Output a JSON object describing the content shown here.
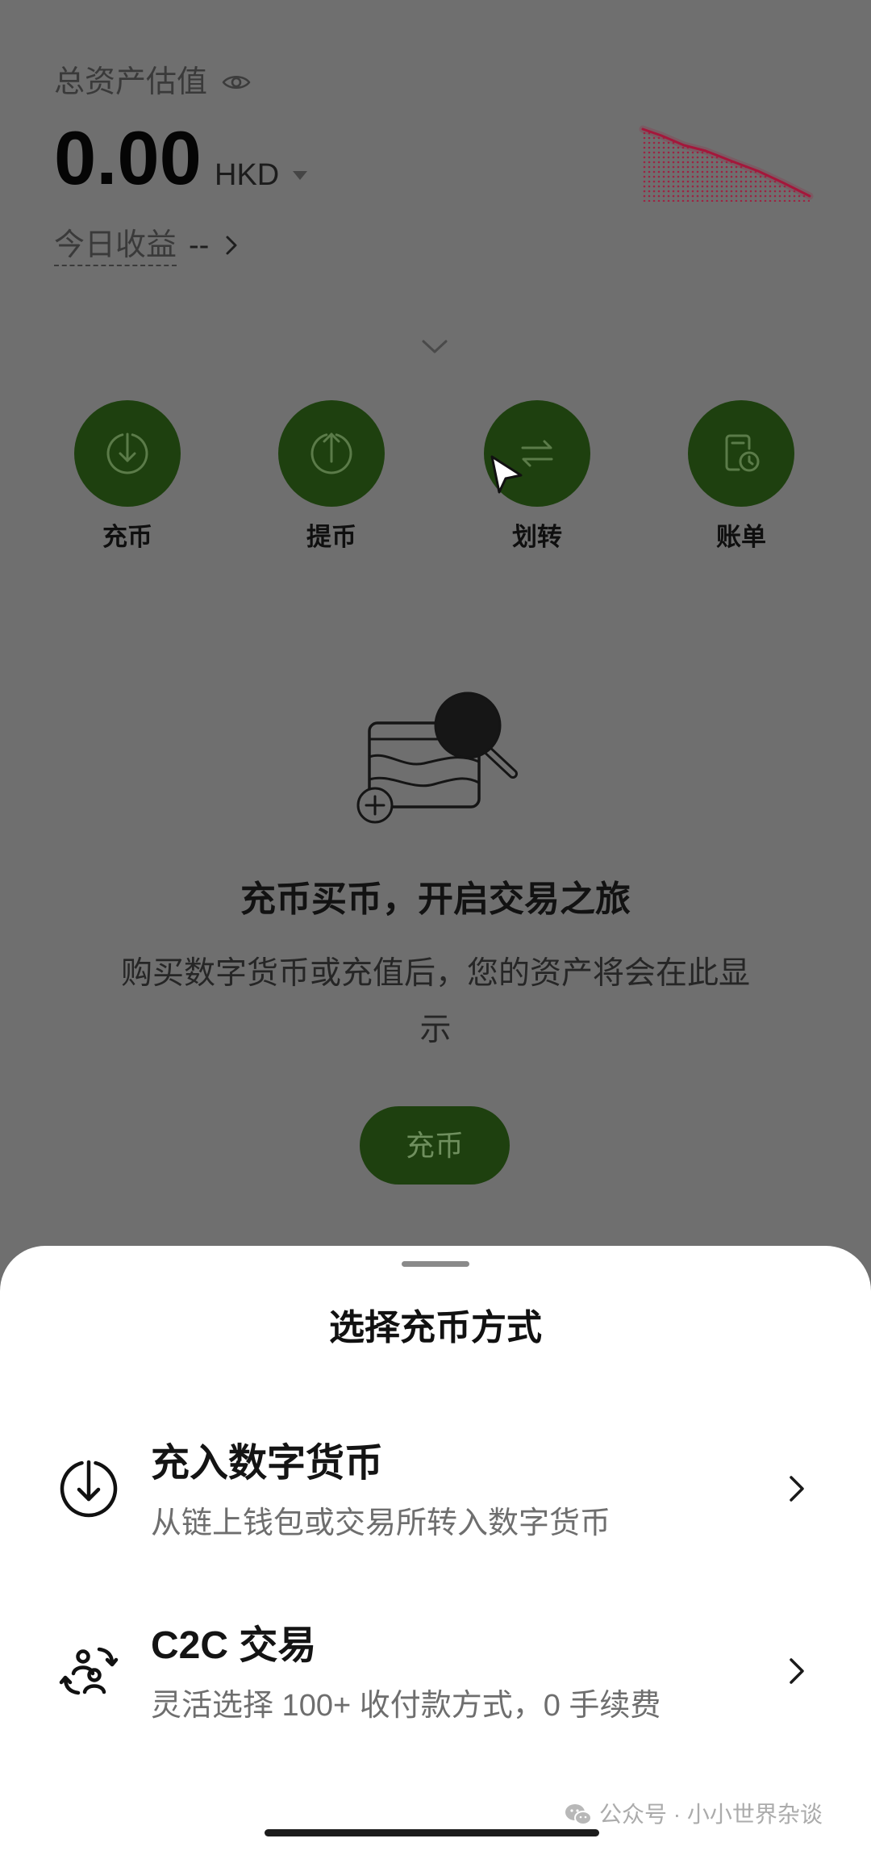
{
  "assets": {
    "label": "总资产估值",
    "visibility_icon": "eye-icon",
    "amount": "0.00",
    "currency": "HKD",
    "today_label": "今日收益",
    "today_value": "--"
  },
  "actions": [
    {
      "label": "充币",
      "icon": "deposit-icon"
    },
    {
      "label": "提币",
      "icon": "withdraw-icon"
    },
    {
      "label": "划转",
      "icon": "transfer-icon"
    },
    {
      "label": "账单",
      "icon": "bill-icon"
    }
  ],
  "empty_state": {
    "illustration": "wallet-search-illustration",
    "title": "充币买币，开启交易之旅",
    "description": "购买数字货币或充值后，您的资产将会在此显示",
    "button_label": "充币"
  },
  "deposit_sheet": {
    "title": "选择充币方式",
    "options": [
      {
        "title": "充入数字货币",
        "subtitle": "从链上钱包或交易所转入数字货币",
        "icon": "download-circle-icon"
      },
      {
        "title": "C2C 交易",
        "subtitle": "灵活选择 100+ 收付款方式，0 手续费",
        "icon": "c2c-exchange-icon"
      }
    ]
  },
  "watermark": {
    "icon": "wechat-icon",
    "text": "公众号 · 小小世界杂谈"
  },
  "colors": {
    "backdrop": "#6f6f6f",
    "action_green": "#1e400f",
    "action_icon": "#5b7b49",
    "button_text": "#6f8f5e",
    "sparkline": "#a4173b",
    "sheet_bg": "#ffffff",
    "handle": "#8a8a8a",
    "home_indicator": "#1c1c1c"
  }
}
